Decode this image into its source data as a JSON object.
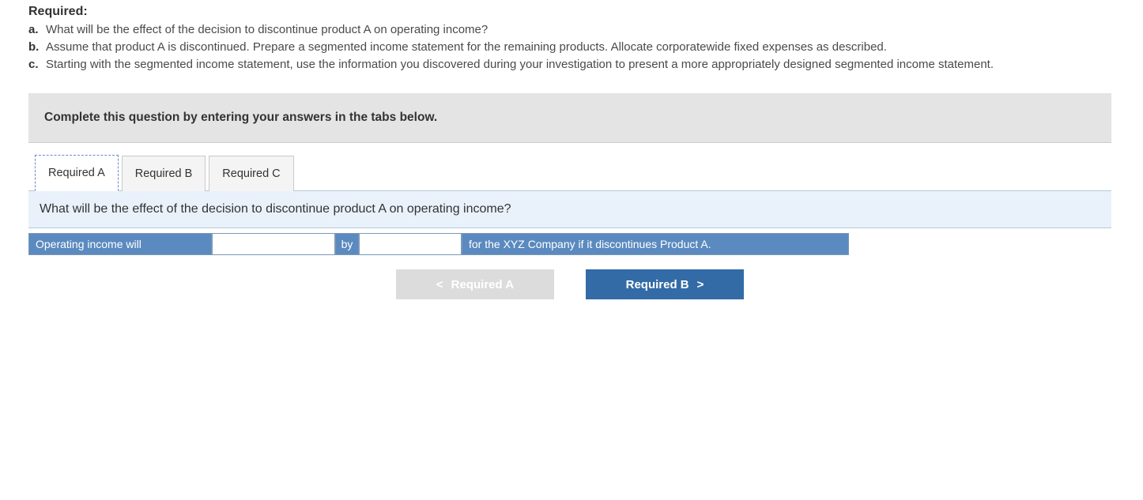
{
  "required": {
    "title": "Required:",
    "items": [
      {
        "letter": "a.",
        "text": "What will be the effect of the decision to discontinue product A on operating income?"
      },
      {
        "letter": "b.",
        "text": "Assume that product A is discontinued. Prepare a segmented income statement for the remaining products. Allocate corporatewide fixed expenses as described."
      },
      {
        "letter": "c.",
        "text": "Starting with the segmented income statement, use the information you discovered during your investigation to present a more appropriately designed segmented income statement."
      }
    ]
  },
  "instruction": "Complete this question by entering your answers in the tabs below.",
  "tabs": {
    "items": [
      {
        "label": "Required A",
        "active": true
      },
      {
        "label": "Required B",
        "active": false
      },
      {
        "label": "Required C",
        "active": false
      }
    ]
  },
  "question": "What will be the effect of the decision to discontinue product A on operating income?",
  "answer": {
    "lead": "Operating income will",
    "by": "by",
    "tail": "for the XYZ Company if it discontinues Product A.",
    "select_value": "",
    "amount_value": ""
  },
  "nav": {
    "prev": {
      "label": "Required A",
      "chev": "<"
    },
    "next": {
      "label": "Required B",
      "chev": ">"
    }
  }
}
